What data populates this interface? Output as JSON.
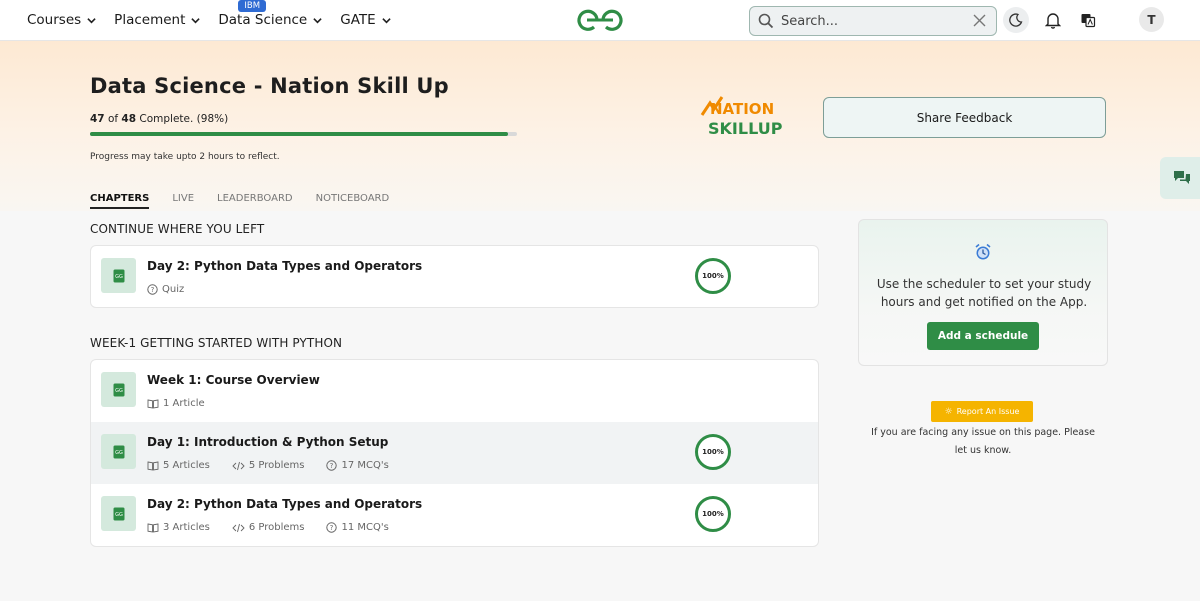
{
  "nav": {
    "items": [
      {
        "label": "Courses"
      },
      {
        "label": "Placement"
      },
      {
        "label": "Data Science",
        "badge": "IBM"
      },
      {
        "label": "GATE"
      }
    ],
    "search_placeholder": "Search...",
    "avatar_initial": "T",
    "brand_color": "#2f8d46"
  },
  "hero": {
    "title": "Data Science - Nation Skill Up",
    "progress_done": "47",
    "progress_of": " of ",
    "progress_total": "48",
    "progress_suffix": " Complete. (98%)",
    "progress_fraction": 0.98,
    "progress_note": "Progress may take upto 2 hours to reflect.",
    "logo_line1": "NATION",
    "logo_line2": "SKILLUP",
    "feedback_label": "Share Feedback"
  },
  "tabs": [
    {
      "label": "CHAPTERS",
      "active": true
    },
    {
      "label": "LIVE"
    },
    {
      "label": "LEADERBOARD"
    },
    {
      "label": "NOTICEBOARD"
    }
  ],
  "continue": {
    "heading": "CONTINUE WHERE YOU LEFT",
    "item": {
      "title": "Day 2: Python Data Types and Operators",
      "meta": "Quiz",
      "progress": "100%"
    }
  },
  "week1": {
    "heading": "WEEK-1 GETTING STARTED WITH PYTHON",
    "rows": [
      {
        "title": "Week 1: Course Overview",
        "articles": "1 Article"
      },
      {
        "title": "Day 1: Introduction & Python Setup",
        "articles": "5 Articles",
        "problems": "5 Problems",
        "mcqs": "17 MCQ's",
        "progress": "100%"
      },
      {
        "title": "Day 2: Python Data Types and Operators",
        "articles": "3 Articles",
        "problems": "6 Problems",
        "mcqs": "11 MCQ's",
        "progress": "100%"
      }
    ]
  },
  "scheduler": {
    "text": "Use the scheduler to set your study hours and get notified on the App.",
    "button": "Add a schedule"
  },
  "report": {
    "button": "Report An Issue",
    "text": "If you are facing any issue on this page. Please let us know."
  }
}
